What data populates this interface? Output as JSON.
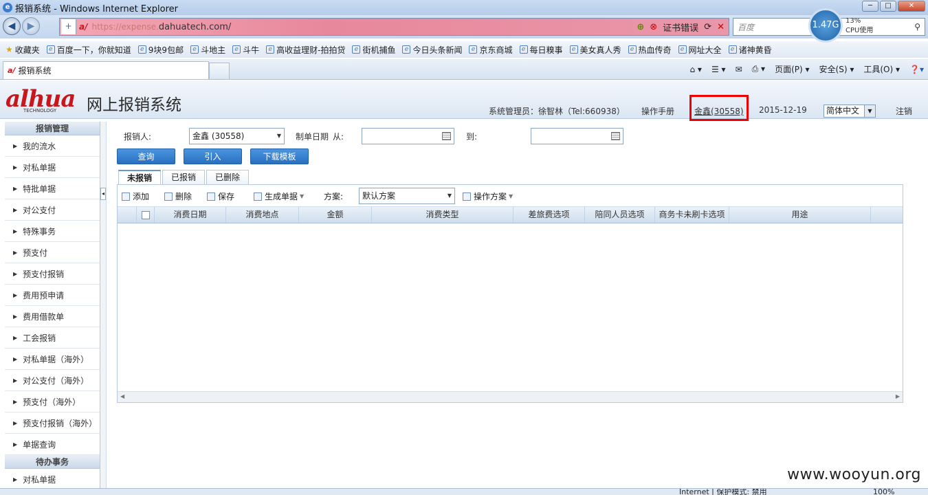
{
  "window": {
    "title": "报销系统 - Windows Internet Explorer",
    "controls": [
      "─",
      "□",
      "✕"
    ]
  },
  "address": {
    "url_prefix": "https://expense.",
    "url_host": "dahuatech.com/",
    "cert_error": "证书错误",
    "search_placeholder": "百度"
  },
  "cpu": {
    "freq": "1.47G",
    "percent": "13%",
    "label": "CPU使用"
  },
  "favorites": {
    "label": "收藏夹",
    "items": [
      "百度一下，你就知道",
      "9块9包邮",
      "斗地主",
      "斗牛",
      "高收益理财-拍拍贷",
      "街机捕鱼",
      "今日头条新闻",
      "京东商城",
      "每日糗事",
      "美女真人秀",
      "热血传奇",
      "网址大全",
      "诸神黄昏"
    ]
  },
  "browser_tab": {
    "label": "报销系统"
  },
  "commandbar": {
    "page": "页面(P)",
    "safety": "安全(S)",
    "tools": "工具(O)"
  },
  "header": {
    "logo": "alhua",
    "logo_sub": "TECHNOLOGY",
    "system_title": "网上报销系统",
    "admin": "系统管理员：徐智林（Tel:660938）",
    "manual": "操作手册",
    "user": "金鑫(30558)",
    "date": "2015-12-19",
    "language": "简体中文",
    "logout": "注销"
  },
  "sidebar": {
    "section1": "报销管理",
    "items": [
      "我的流水",
      "对私单据",
      "特批单据",
      "对公支付",
      "特殊事务",
      "预支付",
      "预支付报销",
      "费用预申请",
      "费用借款单",
      "工会报销",
      "对私单据（海外）",
      "对公支付（海外）",
      "预支付（海外）",
      "预支付报销（海外）",
      "单据查询"
    ],
    "section2": "待办事务",
    "items2": [
      "对私单据"
    ]
  },
  "form": {
    "reporter_label": "报销人:",
    "reporter_value": "金鑫 (30558)",
    "date_label": "制单日期",
    "from_label": "从:",
    "to_label": "到:",
    "query_btn": "查询",
    "import_btn": "引入",
    "download_btn": "下载模板"
  },
  "tabs": [
    "未报销",
    "已报销",
    "已删除"
  ],
  "toolbar": {
    "add": "添加",
    "delete": "删除",
    "save": "保存",
    "generate": "生成单据",
    "scheme_label": "方案:",
    "scheme_value": "默认方案",
    "scheme_ops": "操作方案"
  },
  "grid": {
    "columns": [
      "消费日期",
      "消费地点",
      "金额",
      "消费类型",
      "差旅费选项",
      "陪同人员选项",
      "商务卡未刷卡选项",
      "用途"
    ]
  },
  "statusbar": {
    "zone": "Internet | 保护模式: 禁用",
    "zoom": "100%"
  },
  "watermark": "www.wooyun.org"
}
